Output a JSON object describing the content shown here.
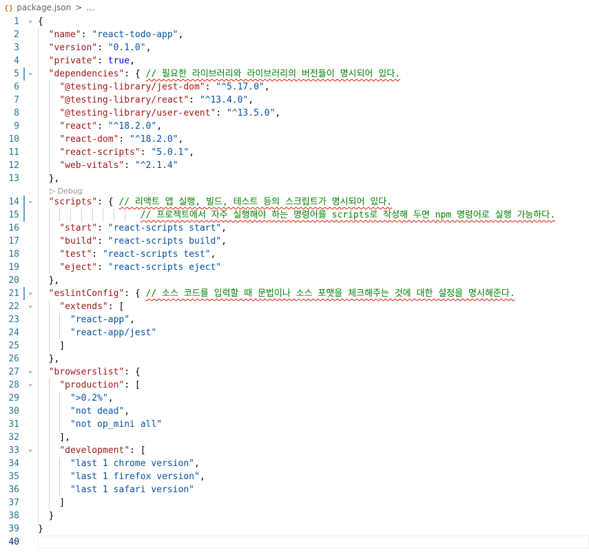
{
  "breadcrumb": {
    "icon": "{}",
    "file": "package.json",
    "sep": ">",
    "more": "..."
  },
  "codelens": {
    "label": "Debug",
    "icon": "debug-icon"
  },
  "lines": [
    {
      "n": "1",
      "fold": "v",
      "tokens": [
        [
          "p",
          "{"
        ]
      ]
    },
    {
      "n": "2",
      "tokens": [
        [
          "p",
          "  "
        ],
        [
          "k",
          "\"name\""
        ],
        [
          "p",
          ": "
        ],
        [
          "s",
          "\"react-todo-app\""
        ],
        [
          "p",
          ","
        ]
      ]
    },
    {
      "n": "3",
      "tokens": [
        [
          "p",
          "  "
        ],
        [
          "k",
          "\"version\""
        ],
        [
          "p",
          ": "
        ],
        [
          "s",
          "\"0.1.0\""
        ],
        [
          "p",
          ","
        ]
      ]
    },
    {
      "n": "4",
      "tokens": [
        [
          "p",
          "  "
        ],
        [
          "k",
          "\"private\""
        ],
        [
          "p",
          ": "
        ],
        [
          "t",
          "true"
        ],
        [
          "p",
          ","
        ]
      ]
    },
    {
      "n": "5",
      "fold": "v",
      "mod": true,
      "tokens": [
        [
          "p",
          "  "
        ],
        [
          "k",
          "\"dependencies\""
        ],
        [
          "p",
          ": { "
        ],
        [
          "c",
          "// 필요한 라이브러리와 라이브러리의 버전들이 명시되어 있다."
        ]
      ]
    },
    {
      "n": "6",
      "tokens": [
        [
          "p",
          "    "
        ],
        [
          "k",
          "\"@testing-library/jest-dom\""
        ],
        [
          "p",
          ": "
        ],
        [
          "s",
          "\"^5.17.0\""
        ],
        [
          "p",
          ","
        ]
      ]
    },
    {
      "n": "7",
      "tokens": [
        [
          "p",
          "    "
        ],
        [
          "k",
          "\"@testing-library/react\""
        ],
        [
          "p",
          ": "
        ],
        [
          "s",
          "\"^13.4.0\""
        ],
        [
          "p",
          ","
        ]
      ]
    },
    {
      "n": "8",
      "tokens": [
        [
          "p",
          "    "
        ],
        [
          "k",
          "\"@testing-library/user-event\""
        ],
        [
          "p",
          ": "
        ],
        [
          "s",
          "\"^13.5.0\""
        ],
        [
          "p",
          ","
        ]
      ]
    },
    {
      "n": "9",
      "tokens": [
        [
          "p",
          "    "
        ],
        [
          "k",
          "\"react\""
        ],
        [
          "p",
          ": "
        ],
        [
          "s",
          "\"^18.2.0\""
        ],
        [
          "p",
          ","
        ]
      ]
    },
    {
      "n": "10",
      "tokens": [
        [
          "p",
          "    "
        ],
        [
          "k",
          "\"react-dom\""
        ],
        [
          "p",
          ": "
        ],
        [
          "s",
          "\"^18.2.0\""
        ],
        [
          "p",
          ","
        ]
      ]
    },
    {
      "n": "11",
      "tokens": [
        [
          "p",
          "    "
        ],
        [
          "k",
          "\"react-scripts\""
        ],
        [
          "p",
          ": "
        ],
        [
          "s",
          "\"5.0.1\""
        ],
        [
          "p",
          ","
        ]
      ]
    },
    {
      "n": "12",
      "tokens": [
        [
          "p",
          "    "
        ],
        [
          "k",
          "\"web-vitals\""
        ],
        [
          "p",
          ": "
        ],
        [
          "s",
          "\"^2.1.4\""
        ]
      ]
    },
    {
      "n": "13",
      "tokens": [
        [
          "p",
          "  },"
        ]
      ]
    },
    {
      "n": "14",
      "fold": "v",
      "mod": true,
      "tokens": [
        [
          "p",
          "  "
        ],
        [
          "k",
          "\"scripts\""
        ],
        [
          "p",
          ": { "
        ],
        [
          "c",
          "// 리액트 앱 실행, 빌드, 테스트 등의 스크립트가 명시되어 있다."
        ]
      ]
    },
    {
      "n": "15",
      "mod": true,
      "tokens": [
        [
          "p",
          "                   "
        ],
        [
          "c",
          "// 프로젝트에서 자주 실행해야 하는 명령어를 scripts로 작성해 두면 npm 명령어로 실행 가능하다."
        ]
      ]
    },
    {
      "n": "16",
      "tokens": [
        [
          "p",
          "    "
        ],
        [
          "k",
          "\"start\""
        ],
        [
          "p",
          ": "
        ],
        [
          "s",
          "\"react-scripts start\""
        ],
        [
          "p",
          ","
        ]
      ]
    },
    {
      "n": "17",
      "tokens": [
        [
          "p",
          "    "
        ],
        [
          "k",
          "\"build\""
        ],
        [
          "p",
          ": "
        ],
        [
          "s",
          "\"react-scripts build\""
        ],
        [
          "p",
          ","
        ]
      ]
    },
    {
      "n": "18",
      "tokens": [
        [
          "p",
          "    "
        ],
        [
          "k",
          "\"test\""
        ],
        [
          "p",
          ": "
        ],
        [
          "s",
          "\"react-scripts test\""
        ],
        [
          "p",
          ","
        ]
      ]
    },
    {
      "n": "19",
      "tokens": [
        [
          "p",
          "    "
        ],
        [
          "k",
          "\"eject\""
        ],
        [
          "p",
          ": "
        ],
        [
          "s",
          "\"react-scripts eject\""
        ]
      ]
    },
    {
      "n": "20",
      "tokens": [
        [
          "p",
          "  },"
        ]
      ]
    },
    {
      "n": "21",
      "fold": "v",
      "mod": true,
      "tokens": [
        [
          "p",
          "  "
        ],
        [
          "k",
          "\"eslintConfig\""
        ],
        [
          "p",
          ": { "
        ],
        [
          "c",
          "// 소스 코드를 입력할 때 문법이나 소스 포맷을 체크해주는 것에 대한 설정을 명시해준다."
        ]
      ]
    },
    {
      "n": "22",
      "fold": "v",
      "tokens": [
        [
          "p",
          "    "
        ],
        [
          "k",
          "\"extends\""
        ],
        [
          "p",
          ": ["
        ]
      ]
    },
    {
      "n": "23",
      "tokens": [
        [
          "p",
          "      "
        ],
        [
          "s",
          "\"react-app\""
        ],
        [
          "p",
          ","
        ]
      ]
    },
    {
      "n": "24",
      "tokens": [
        [
          "p",
          "      "
        ],
        [
          "s",
          "\"react-app/jest\""
        ]
      ]
    },
    {
      "n": "25",
      "tokens": [
        [
          "p",
          "    ]"
        ]
      ]
    },
    {
      "n": "26",
      "tokens": [
        [
          "p",
          "  },"
        ]
      ]
    },
    {
      "n": "27",
      "fold": "v",
      "tokens": [
        [
          "p",
          "  "
        ],
        [
          "k",
          "\"browserslist\""
        ],
        [
          "p",
          ": {"
        ]
      ]
    },
    {
      "n": "28",
      "fold": "v",
      "tokens": [
        [
          "p",
          "    "
        ],
        [
          "k",
          "\"production\""
        ],
        [
          "p",
          ": ["
        ]
      ]
    },
    {
      "n": "29",
      "tokens": [
        [
          "p",
          "      "
        ],
        [
          "s",
          "\">0.2%\""
        ],
        [
          "p",
          ","
        ]
      ]
    },
    {
      "n": "30",
      "tokens": [
        [
          "p",
          "      "
        ],
        [
          "s",
          "\"not dead\""
        ],
        [
          "p",
          ","
        ]
      ]
    },
    {
      "n": "31",
      "tokens": [
        [
          "p",
          "      "
        ],
        [
          "s",
          "\"not op_mini all\""
        ]
      ]
    },
    {
      "n": "32",
      "tokens": [
        [
          "p",
          "    ],"
        ]
      ]
    },
    {
      "n": "33",
      "fold": "v",
      "tokens": [
        [
          "p",
          "    "
        ],
        [
          "k",
          "\"development\""
        ],
        [
          "p",
          ": ["
        ]
      ]
    },
    {
      "n": "34",
      "tokens": [
        [
          "p",
          "      "
        ],
        [
          "s",
          "\"last 1 chrome version\""
        ],
        [
          "p",
          ","
        ]
      ]
    },
    {
      "n": "35",
      "tokens": [
        [
          "p",
          "      "
        ],
        [
          "s",
          "\"last 1 firefox version\""
        ],
        [
          "p",
          ","
        ]
      ]
    },
    {
      "n": "36",
      "tokens": [
        [
          "p",
          "      "
        ],
        [
          "s",
          "\"last 1 safari version\""
        ]
      ]
    },
    {
      "n": "37",
      "tokens": [
        [
          "p",
          "    ]"
        ]
      ]
    },
    {
      "n": "38",
      "tokens": [
        [
          "p",
          "  }"
        ]
      ]
    },
    {
      "n": "39",
      "tokens": [
        [
          "p",
          "}"
        ]
      ]
    },
    {
      "n": "40",
      "current": true,
      "tokens": []
    }
  ],
  "colors": {
    "key": "#a31515",
    "string": "#0451a5",
    "keyword": "#0000ff",
    "comment": "#008000",
    "line_number": "#237893",
    "squiggle": "#e51400"
  }
}
